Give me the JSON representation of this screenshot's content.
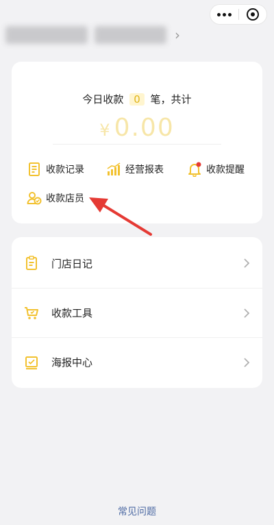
{
  "topbar": {
    "capsule_menu": "more-icon",
    "capsule_close": "close-icon"
  },
  "summary": {
    "today_prefix": "今日收款",
    "count": "0",
    "today_suffix": "笔，共计",
    "currency": "¥",
    "amount": "0.00"
  },
  "actions": [
    {
      "label": "收款记录",
      "icon": "receipt-icon"
    },
    {
      "label": "经营报表",
      "icon": "chart-icon"
    },
    {
      "label": "收款提醒",
      "icon": "bell-icon"
    },
    {
      "label": "收款店员",
      "icon": "staff-icon"
    }
  ],
  "list": [
    {
      "label": "门店日记",
      "icon": "diary-icon"
    },
    {
      "label": "收款工具",
      "icon": "cart-icon"
    },
    {
      "label": "海报中心",
      "icon": "poster-icon"
    }
  ],
  "footer": {
    "faq": "常见问题"
  },
  "colors": {
    "accent": "#f2c12e",
    "annotation": "#e53a34",
    "link": "#4d6aa3"
  }
}
